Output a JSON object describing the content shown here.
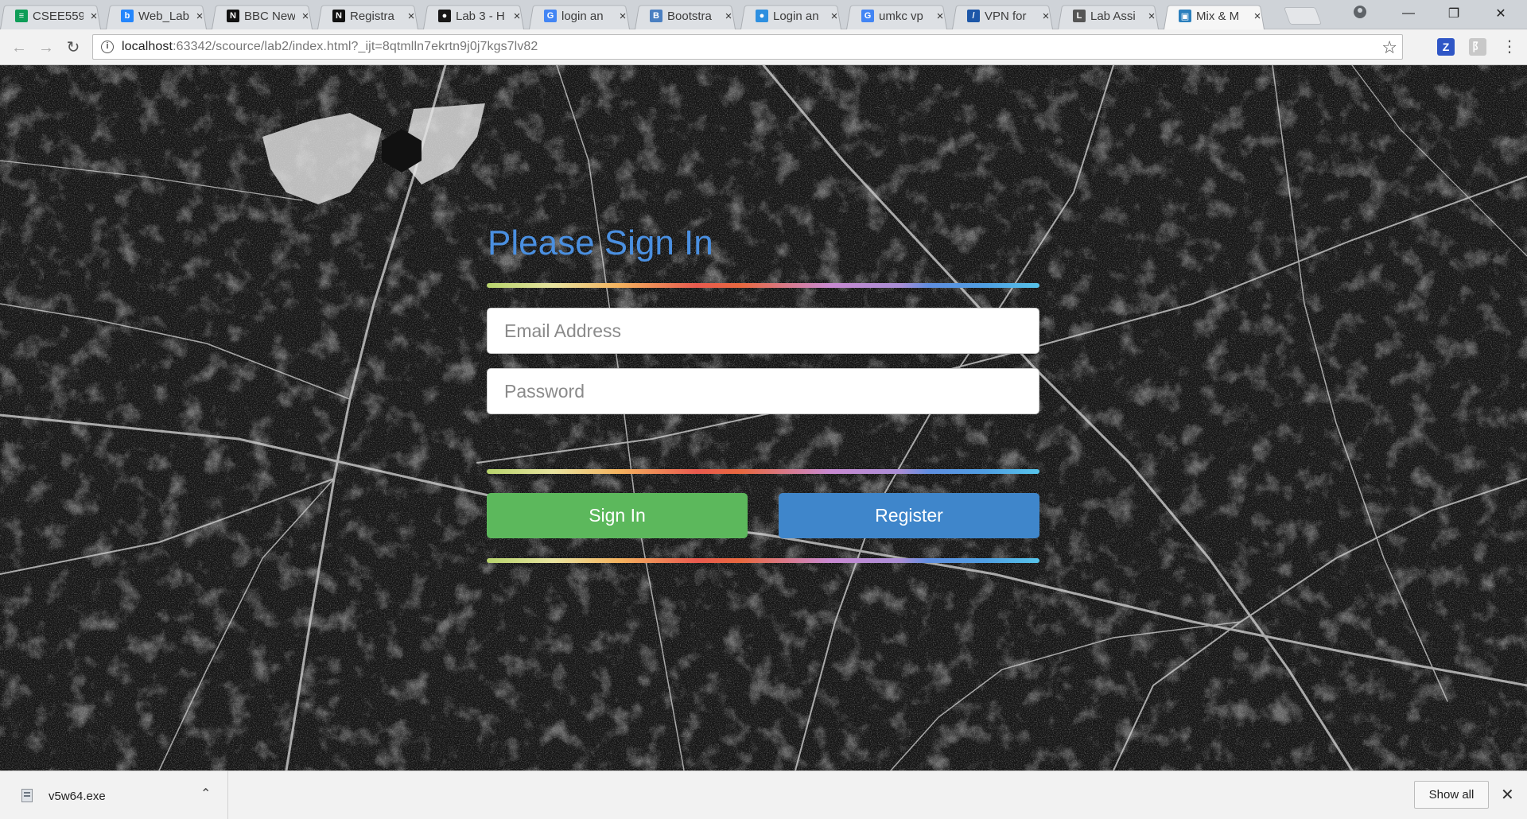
{
  "browser": {
    "tabs": [
      {
        "title": "CSEE559",
        "icon": "sheets-icon",
        "color": "#0f9d58"
      },
      {
        "title": "Web_Lab",
        "icon": "box-icon",
        "color": "#2486fc"
      },
      {
        "title": "BBC New",
        "icon": "notion-icon",
        "color": "#111111"
      },
      {
        "title": "Registra",
        "icon": "notion-icon",
        "color": "#111111"
      },
      {
        "title": "Lab 3 - H",
        "icon": "github-icon",
        "color": "#181717"
      },
      {
        "title": "login an",
        "icon": "google-icon",
        "color": "#4285f4"
      },
      {
        "title": "Bootstra",
        "icon": "bootstrap-icon",
        "color": "#4a7fc1"
      },
      {
        "title": "Login an",
        "icon": "drop-icon",
        "color": "#2d8fe0"
      },
      {
        "title": "umkc vp",
        "icon": "google-icon",
        "color": "#4285f4"
      },
      {
        "title": "VPN for",
        "icon": "vpn-icon",
        "color": "#1d57a8"
      },
      {
        "title": "Lab Assi",
        "icon": "lab-icon",
        "color": "#555555"
      },
      {
        "title": "Mix & M",
        "icon": "mix-icon",
        "color": "#2a7fbd"
      }
    ],
    "active_tab": 11,
    "url_host": "localhost",
    "url_rest": ":63342/scource/lab2/index.html?_ijt=8qtmlln7ekrtn9j0j7kgs7lv82",
    "extensions": [
      {
        "label": "Z",
        "color": "#2f56c6"
      },
      {
        "label": "阝",
        "color": "#c8c8c8"
      }
    ]
  },
  "page": {
    "title": "Please Sign In",
    "email_placeholder": "Email Address",
    "password_placeholder": "Password",
    "signin_label": "Sign In",
    "register_label": "Register",
    "colors": {
      "title": "#4a8fe0",
      "signin": "#5cb85c",
      "register": "#3f86cb"
    }
  },
  "downloads": {
    "file_name": "v5w64.exe",
    "show_all_label": "Show all"
  }
}
